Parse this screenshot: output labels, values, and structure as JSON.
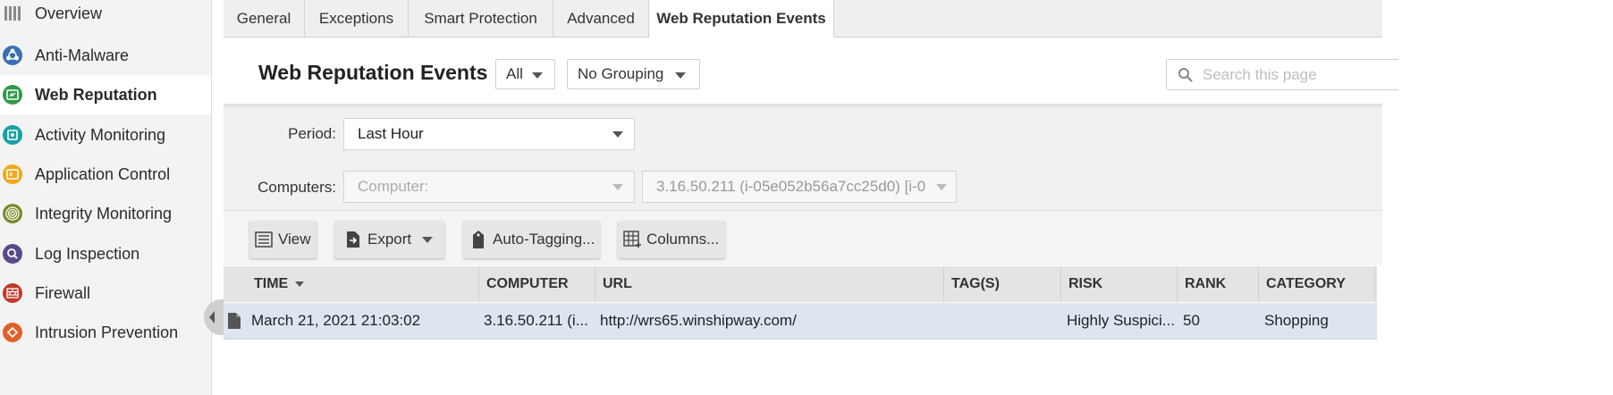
{
  "sidebar": {
    "items": [
      {
        "label": "Overview",
        "icon": "overview-icon",
        "color": "#8a8a8a"
      },
      {
        "label": "Anti-Malware",
        "icon": "biohazard-icon",
        "color": "#3a6fb3"
      },
      {
        "label": "Web Reputation",
        "icon": "web-reputation-icon",
        "color": "#2e9a48"
      },
      {
        "label": "Activity Monitoring",
        "icon": "activity-monitoring-icon",
        "color": "#1aa0a5"
      },
      {
        "label": "Application Control",
        "icon": "application-control-icon",
        "color": "#f0a818"
      },
      {
        "label": "Integrity Monitoring",
        "icon": "fingerprint-icon",
        "color": "#7a8a2a"
      },
      {
        "label": "Log Inspection",
        "icon": "magnifier-icon",
        "color": "#5a4a8a"
      },
      {
        "label": "Firewall",
        "icon": "firewall-icon",
        "color": "#c0392b"
      },
      {
        "label": "Intrusion Prevention",
        "icon": "intrusion-prevention-icon",
        "color": "#e0622a"
      }
    ],
    "active_index": 2
  },
  "tabs": [
    "General",
    "Exceptions",
    "Smart Protection",
    "Advanced",
    "Web Reputation Events"
  ],
  "active_tab": "Web Reputation Events",
  "header": {
    "title": "Web Reputation Events",
    "filter_value": "All",
    "grouping_value": "No Grouping",
    "search_placeholder": "Search this page"
  },
  "filters": {
    "period_label": "Period:",
    "period_value": "Last Hour",
    "computers_label": "Computers:",
    "computer_placeholder": "Computer:",
    "computer_value": "3.16.50.211 (i-05e052b56a7cc25d0) [i-0"
  },
  "toolbar": {
    "view": "View",
    "export": "Export",
    "auto_tagging": "Auto-Tagging...",
    "columns": "Columns..."
  },
  "table": {
    "columns": [
      "TIME",
      "COMPUTER",
      "URL",
      "TAG(S)",
      "RISK",
      "RANK",
      "CATEGORY"
    ],
    "sorted_column": "TIME",
    "rows": [
      {
        "time": "March 21, 2021 21:03:02",
        "computer": "3.16.50.211 (i...",
        "url": "http://wrs65.winshipway.com/",
        "tags": "",
        "risk": "Highly Suspici...",
        "rank": "50",
        "category": "Shopping"
      }
    ]
  },
  "colors": {
    "sidebar_bg": "#f3f3f3",
    "selected_row": "#dde6f0",
    "header_bg": "#e4e4e4"
  }
}
